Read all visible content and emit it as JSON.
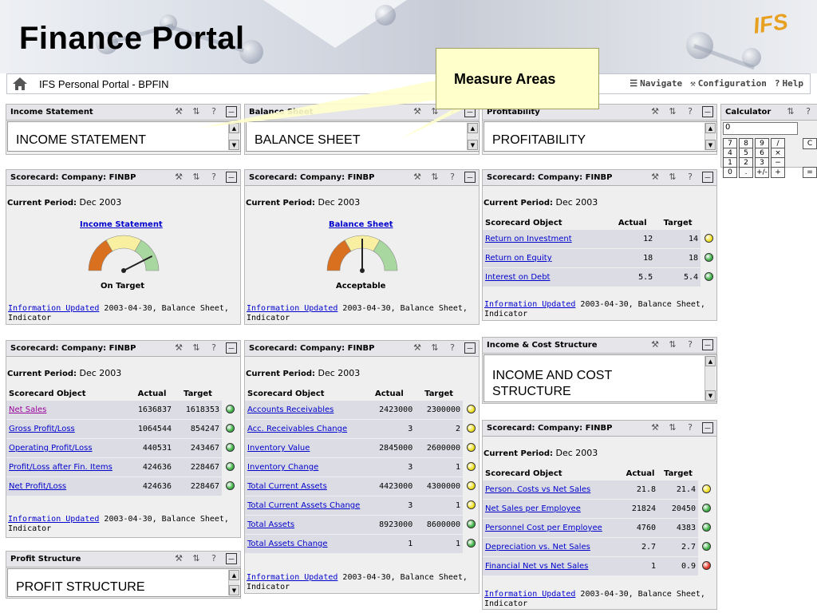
{
  "page_title": "Finance Portal",
  "logo_text": "IFS",
  "portal": {
    "title": "IFS Personal Portal - BPFIN",
    "nav": [
      {
        "icon": "navigate-icon",
        "label": "Navigate"
      },
      {
        "icon": "configuration-icon",
        "label": "Configuration"
      },
      {
        "icon": "help-icon",
        "label": "Help"
      }
    ]
  },
  "callout": {
    "text": "Measure Areas"
  },
  "colors": {
    "green": "#3cb043",
    "yellow": "#f0e020",
    "red": "#e03020",
    "gauge_orange": "#d87020",
    "gauge_yellow": "#f8f0a0",
    "gauge_green": "#a8d8a0"
  },
  "income_statement": {
    "header": "Income Statement",
    "text": "INCOME STATEMENT"
  },
  "balance_sheet": {
    "header": "Balance Sheet",
    "text": "BALANCE SHEET"
  },
  "profitability": {
    "header": "Profitability",
    "text": "PROFITABILITY"
  },
  "calculator": {
    "header": "Calculator",
    "value": "0",
    "keys": [
      "7",
      "8",
      "9",
      "/",
      "C",
      "4",
      "5",
      "6",
      "×",
      "1",
      "2",
      "3",
      "−",
      "0",
      ".",
      "+/-",
      "+",
      "="
    ]
  },
  "sc_gauge_income": {
    "header": "Scorecard: Company: FINBP",
    "period_label": "Current Period:",
    "period": "Dec 2003",
    "link": "Income Statement",
    "status": "On Target",
    "gauge_level": 0.85,
    "updated_link": "Information Updated",
    "updated_text": "2003-04-30, Balance Sheet,",
    "updated_text2": "Indicator"
  },
  "sc_gauge_balance": {
    "header": "Scorecard: Company: FINBP",
    "period_label": "Current Period:",
    "period": "Dec 2003",
    "link": "Balance Sheet",
    "status": "Acceptable",
    "gauge_level": 0.5,
    "updated_link": "Information Updated",
    "updated_text": "2003-04-30, Balance Sheet,",
    "updated_text2": "Indicator"
  },
  "sc_profitability": {
    "header": "Scorecard: Company: FINBP",
    "period_label": "Current Period:",
    "period": "Dec 2003",
    "col_object": "Scorecard Object",
    "col_actual": "Actual",
    "col_target": "Target",
    "rows": [
      {
        "object": "Return on Investment",
        "actual": "12",
        "target": "14",
        "status": "yellow"
      },
      {
        "object": "Return on Equity",
        "actual": "18",
        "target": "18",
        "status": "green"
      },
      {
        "object": "Interest on Debt",
        "actual": "5.5",
        "target": "5.4",
        "status": "green"
      }
    ],
    "updated_link": "Information Updated",
    "updated_text": "2003-04-30, Balance Sheet,",
    "updated_text2": "Indicator"
  },
  "sc_income": {
    "header": "Scorecard: Company: FINBP",
    "period_label": "Current Period:",
    "period": "Dec 2003",
    "col_object": "Scorecard Object",
    "col_actual": "Actual",
    "col_target": "Target",
    "rows": [
      {
        "object": "Net Sales",
        "actual": "1636837",
        "target": "1618353",
        "status": "green",
        "visited": true
      },
      {
        "object": "Gross Profit/Loss",
        "actual": "1064544",
        "target": "854247",
        "status": "green"
      },
      {
        "object": "Operating Profit/Loss",
        "actual": "440531",
        "target": "243467",
        "status": "green"
      },
      {
        "object": "Profit/Loss after Fin. Items",
        "actual": "424636",
        "target": "228467",
        "status": "green"
      },
      {
        "object": "Net Profit/Loss",
        "actual": "424636",
        "target": "228467",
        "status": "green"
      }
    ],
    "updated_link": "Information Updated",
    "updated_text": "2003-04-30, Balance Sheet,",
    "updated_text2": "Indicator"
  },
  "sc_balance": {
    "header": "Scorecard: Company: FINBP",
    "period_label": "Current Period:",
    "period": "Dec 2003",
    "col_object": "Scorecard Object",
    "col_actual": "Actual",
    "col_target": "Target",
    "rows": [
      {
        "object": "Accounts Receivables",
        "actual": "2423000",
        "target": "2300000",
        "status": "yellow"
      },
      {
        "object": "Acc. Receivables Change",
        "actual": "3",
        "target": "2",
        "status": "yellow"
      },
      {
        "object": "Inventory Value",
        "actual": "2845000",
        "target": "2600000",
        "status": "yellow"
      },
      {
        "object": "Inventory Change",
        "actual": "3",
        "target": "1",
        "status": "yellow"
      },
      {
        "object": "Total Current Assets",
        "actual": "4423000",
        "target": "4300000",
        "status": "yellow"
      },
      {
        "object": "Total Current Assets Change",
        "actual": "3",
        "target": "1",
        "status": "yellow"
      },
      {
        "object": "Total Assets",
        "actual": "8923000",
        "target": "8600000",
        "status": "green"
      },
      {
        "object": "Total Assets Change",
        "actual": "1",
        "target": "1",
        "status": "green"
      }
    ],
    "updated_link": "Information Updated",
    "updated_text": "2003-04-30, Balance Sheet,",
    "updated_text2": "Indicator"
  },
  "income_cost": {
    "header": "Income & Cost Structure",
    "text": "INCOME AND COST STRUCTURE"
  },
  "sc_cost": {
    "header": "Scorecard: Company: FINBP",
    "period_label": "Current Period:",
    "period": "Dec 2003",
    "col_object": "Scorecard Object",
    "col_actual": "Actual",
    "col_target": "Target",
    "rows": [
      {
        "object": "Person. Costs vs Net Sales",
        "actual": "21.8",
        "target": "21.4",
        "status": "yellow"
      },
      {
        "object": "Net Sales per Employee",
        "actual": "21824",
        "target": "20450",
        "status": "green"
      },
      {
        "object": "Personnel Cost per Employee",
        "actual": "4760",
        "target": "4383",
        "status": "green"
      },
      {
        "object": "Depreciation vs. Net Sales",
        "actual": "2.7",
        "target": "2.7",
        "status": "green"
      },
      {
        "object": "Financial Net vs Net Sales",
        "actual": "1",
        "target": "0.9",
        "status": "red"
      }
    ],
    "updated_link": "Information Updated",
    "updated_text": "2003-04-30, Balance Sheet,",
    "updated_text2": "Indicator"
  },
  "profit_structure": {
    "header": "Profit Structure",
    "text": "PROFIT STRUCTURE"
  }
}
